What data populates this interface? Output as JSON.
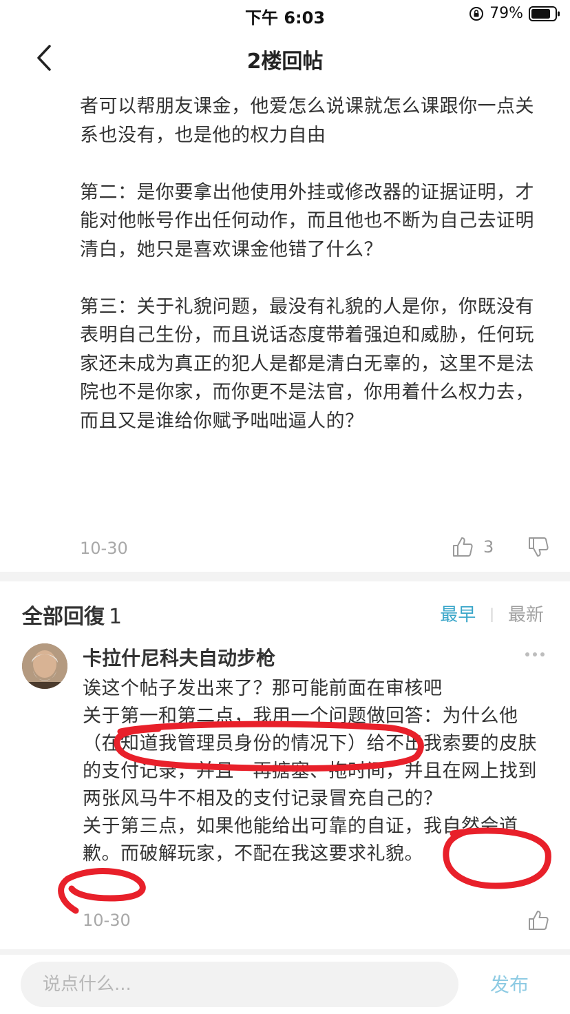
{
  "status_bar": {
    "time": "下午 6:03",
    "battery": "79%"
  },
  "nav": {
    "title": "2楼回帖"
  },
  "post": {
    "paragraphs": [
      "者可以帮朋友课金，他爱怎么说课就怎么课跟你一点关系也没有，也是他的权力自由",
      "第二：是你要拿出他使用外挂或修改器的证据证明，才能对他帐号作出任何动作，而且他也不断为自己去证明清白，她只是喜欢课金他错了什么？",
      "第三：关于礼貌问题，最没有礼貌的人是你，你既没有表明自己生份，而且说话态度带着强迫和威胁，任何玩家还未成为真正的犯人是都是清白无辜的，这里不是法院也不是你家，而你更不是法官，你用着什么权力去，而且又是谁给你赋予咄咄逼人的？"
    ],
    "date": "10-30",
    "like_count": "3"
  },
  "replies": {
    "title": "全部回復",
    "count": "1",
    "sort_earliest": "最早",
    "sort_latest": "最新",
    "items": [
      {
        "author": "卡拉什尼科夫自动步枪",
        "lines": [
          "诶这个帖子发出来了？那可能前面在审核吧",
          "关于第一和第二点，我用一个问题做回答：为什么他 （在知道我管理员身份的情况下）给不出我索要的皮肤的支付记录，并且一再搪塞、拖时间，并且在网上找到两张风马牛不相及的支付记录冒充自己的？",
          "关于第三点，如果他能给出可靠的自证，我自然会道歉。而破解玩家，不配在我这要求礼貌。"
        ],
        "date": "10-30"
      }
    ]
  },
  "composer": {
    "placeholder": "说点什么...",
    "publish_label": "发布"
  },
  "colors": {
    "accent": "#3aa6c9",
    "publish": "#8ecbe3",
    "annotation": "#e8202a"
  }
}
